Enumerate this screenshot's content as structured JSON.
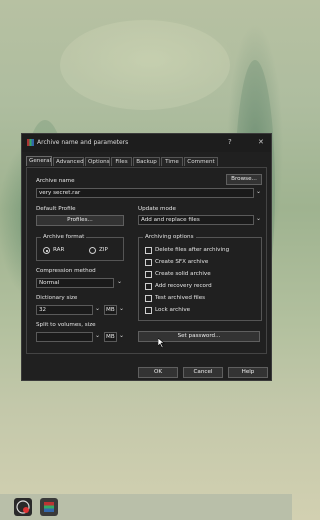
{
  "window": {
    "title": "Archive name and parameters",
    "help_glyph": "?",
    "close_glyph": "✕"
  },
  "tabs": [
    "General",
    "Advanced",
    "Options",
    "Files",
    "Backup",
    "Time",
    "Comment"
  ],
  "general": {
    "archive_name_label": "Archive name",
    "archive_name_value": "very secret.rar",
    "browse_label": "Browse...",
    "default_profile_label": "Default Profile",
    "profiles_label": "Profiles...",
    "update_mode_label": "Update mode",
    "update_mode_value": "Add and replace files",
    "archive_format_label": "Archive format",
    "format_rar": "RAR",
    "format_zip": "ZIP",
    "selected_format": "RAR",
    "compression_method_label": "Compression method",
    "compression_method_value": "Normal",
    "dictionary_size_label": "Dictionary size",
    "dictionary_size_value": "32",
    "dictionary_unit": "MB",
    "split_label": "Split to volumes, size",
    "split_value": "",
    "split_unit": "MB",
    "archiving_options_label": "Archiving options",
    "options": [
      {
        "label": "Delete files after archiving",
        "checked": false
      },
      {
        "label": "Create SFX archive",
        "checked": false
      },
      {
        "label": "Create solid archive",
        "checked": false
      },
      {
        "label": "Add recovery record",
        "checked": false
      },
      {
        "label": "Test archived files",
        "checked": false
      },
      {
        "label": "Lock archive",
        "checked": false
      }
    ],
    "set_password_label": "Set password..."
  },
  "footer": {
    "ok_label": "OK",
    "cancel_label": "Cancel",
    "help_label": "Help"
  },
  "taskbar": {
    "items": [
      "firefox-icon",
      "winrar-icon"
    ]
  },
  "colors": {
    "window_bg": "#202020",
    "text": "#e8e8e8",
    "border": "#5a5a5a"
  }
}
